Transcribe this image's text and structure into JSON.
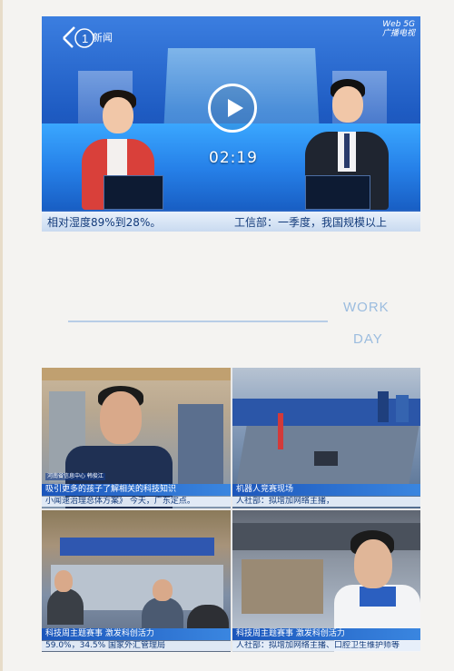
{
  "video": {
    "logo_label": "新闻",
    "corner_logo": "Web 5G\n广播电视",
    "duration": "02:19",
    "ticker_left": "相对湿度89%到28%。",
    "ticker_right": "工信部：一季度，我国规模以上"
  },
  "section": {
    "label_line1": "WORK",
    "label_line2": "DAY"
  },
  "collage": {
    "tile1_tag": "河南省信息中心 韩俊江",
    "tile1_caption": "吸引更多的孩子了解相关的科技知识",
    "tile1_sub": "小闻速治理总体方案》       今天，广东定点。",
    "tile2_caption": "机器人竞赛现场",
    "tile2_sub": "人社部：拟增加网络主播，",
    "tile3_caption": "科技周主题赛事 激发科创活力",
    "tile3_sub": "59.0%，34.5%         国家外汇管理局",
    "tile4_caption": "科技周主题赛事 激发科创活力",
    "tile4_sub": "人社部：拟增加网络主播、口腔卫生维护师等"
  },
  "colors": {
    "accent": "#9bbcdf",
    "ticker_text": "#123a7a",
    "caption_bar": "#1c56bb"
  }
}
